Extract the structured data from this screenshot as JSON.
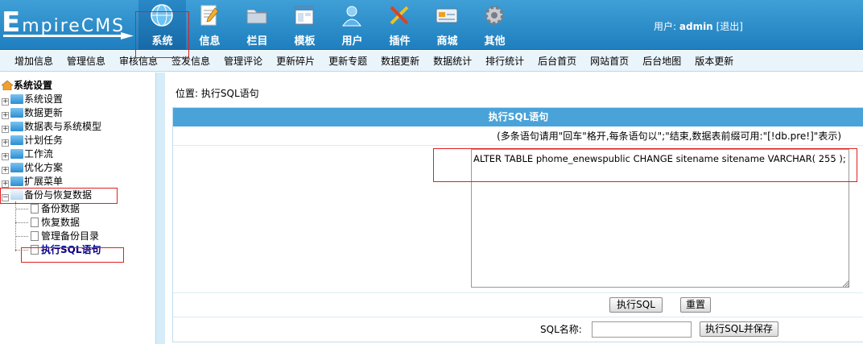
{
  "header": {
    "logo_initial": "E",
    "logo_rest": "mpireCMS",
    "nav": [
      {
        "label": "系统",
        "icon": "globe-icon",
        "active": true
      },
      {
        "label": "信息",
        "icon": "document-edit-icon",
        "active": false
      },
      {
        "label": "栏目",
        "icon": "folder-icon",
        "active": false
      },
      {
        "label": "模板",
        "icon": "template-window-icon",
        "active": false
      },
      {
        "label": "用户",
        "icon": "user-icon",
        "active": false
      },
      {
        "label": "插件",
        "icon": "tools-icon",
        "active": false
      },
      {
        "label": "商城",
        "icon": "credit-card-icon",
        "active": false
      },
      {
        "label": "其他",
        "icon": "gear-icon",
        "active": false
      }
    ],
    "user_label": "用户:",
    "user_name": "admin",
    "logout_label": "[退出]"
  },
  "submenu": [
    "增加信息",
    "管理信息",
    "审核信息",
    "签发信息",
    "管理评论",
    "更新碎片",
    "更新专题",
    "数据更新",
    "数据统计",
    "排行统计",
    "后台首页",
    "网站首页",
    "后台地图",
    "版本更新"
  ],
  "sidebar": {
    "root": "系统设置",
    "items": [
      "系统设置",
      "数据更新",
      "数据表与系统模型",
      "计划任务",
      "工作流",
      "优化方案",
      "扩展菜单",
      "备份与恢复数据"
    ],
    "children": [
      "备份数据",
      "恢复数据",
      "管理备份目录",
      "执行SQL语句"
    ]
  },
  "main": {
    "crumb_label": "位置:",
    "crumb_link": "执行SQL语句",
    "panel_title": "执行SQL语句",
    "note": "(多条语句请用\"回车\"格开,每条语句以\";\"结束,数据表前缀可用:\"[!db.pre!]\"表示)",
    "sql_value": "ALTER TABLE phome_enewspublic CHANGE sitename sitename VARCHAR( 255 );",
    "execute_button": "执行SQL",
    "reset_button": "重置",
    "sql_name_label": "SQL名称:",
    "sql_name_value": "",
    "execute_save_button": "执行SQL并保存"
  },
  "colors": {
    "header_blue": "#2a8cca",
    "panel_head": "#4aa3d8",
    "highlight_red": "#e02020",
    "selected_text": "#00008b"
  }
}
